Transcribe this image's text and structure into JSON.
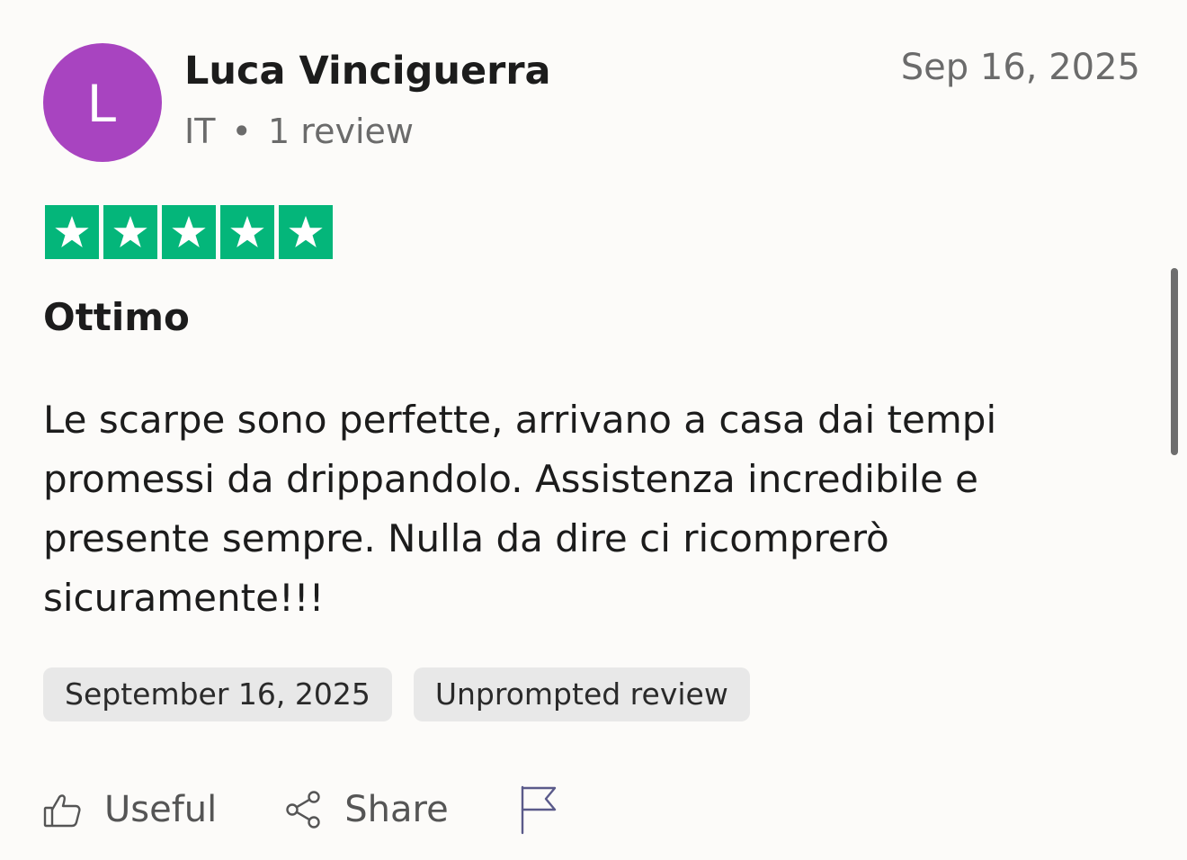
{
  "reviewer": {
    "initial": "L",
    "avatar_color": "#a844c0",
    "name": "Luca Vinciguerra",
    "country": "IT",
    "separator": "•",
    "review_count": "1 review"
  },
  "review": {
    "date": "Sep 16, 2025",
    "rating": 5,
    "max_rating": 5,
    "star_color": "#04b67a",
    "title": "Ottimo",
    "text": "Le scarpe sono perfette, arrivano a casa dai tempi promessi da drippandolo. Assistenza incredibile e presente sempre. Nulla da dire ci ricomprerò sicuramente!!!",
    "tags": [
      "September 16, 2025",
      "Unprompted review"
    ]
  },
  "actions": {
    "useful_label": "Useful",
    "share_label": "Share",
    "useful_icon": "thumbs-up-icon",
    "share_icon": "share-icon",
    "report_icon": "flag-icon"
  }
}
